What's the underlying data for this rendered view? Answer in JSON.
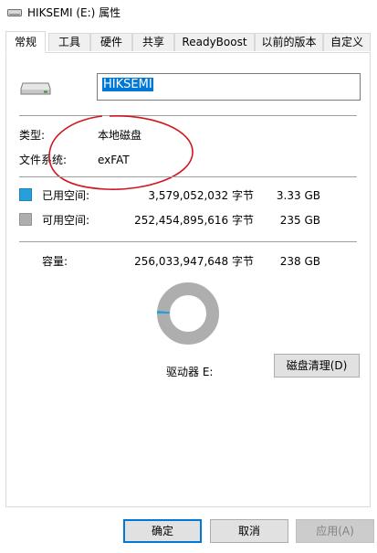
{
  "window": {
    "title": "HIKSEMI (E:) 属性"
  },
  "tabs": [
    {
      "label": "常规"
    },
    {
      "label": "工具"
    },
    {
      "label": "硬件"
    },
    {
      "label": "共享"
    },
    {
      "label": "ReadyBoost"
    },
    {
      "label": "以前的版本"
    },
    {
      "label": "自定义"
    }
  ],
  "drive": {
    "name_value": "HIKSEMI",
    "type_label": "类型:",
    "type_value": "本地磁盘",
    "fs_label": "文件系统:",
    "fs_value": "exFAT",
    "used_label": "已用空间:",
    "used_bytes": "3,579,052,032 字节",
    "used_size": "3.33 GB",
    "free_label": "可用空间:",
    "free_bytes": "252,454,895,616 字节",
    "free_size": "235 GB",
    "capacity_label": "容量:",
    "capacity_bytes": "256,033,947,648 字节",
    "capacity_size": "238 GB",
    "drive_letter_label": "驱动器 E:",
    "used_fraction": 0.014
  },
  "buttons": {
    "cleanup": "磁盘清理(D)",
    "ok": "确定",
    "cancel": "取消",
    "apply": "应用(A)"
  },
  "colors": {
    "used": "#26a0da",
    "free": "#aeaeae",
    "annotation": "#d0161e",
    "selection": "#0078d7"
  },
  "icons": [
    "drive-icon",
    "title-drive-icon"
  ]
}
